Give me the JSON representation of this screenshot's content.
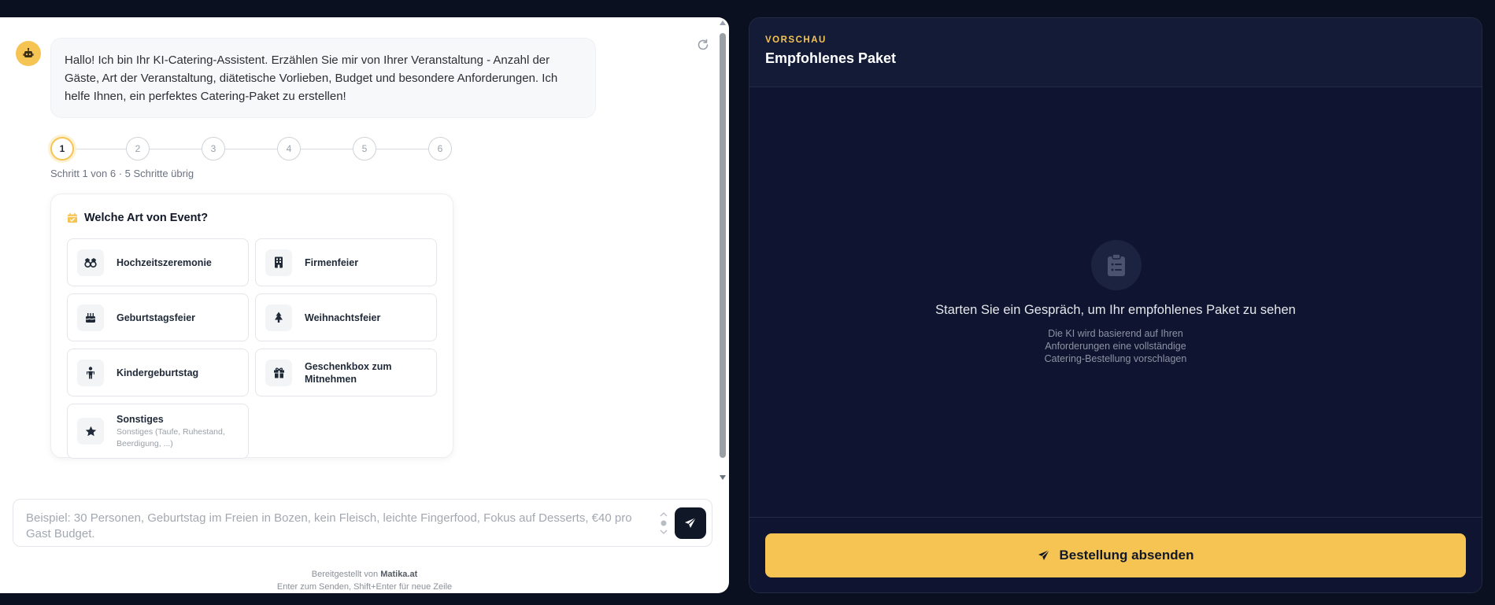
{
  "chat": {
    "bot_message": "Hallo! Ich bin Ihr KI-Catering-Assistent. Erzählen Sie mir von Ihrer Veranstaltung - Anzahl der Gäste, Art der Veranstaltung, diätetische Vorlieben, Budget und besondere Anforderungen. Ich helfe Ihnen, ein perfektes Catering-Paket zu erstellen!",
    "stepper": {
      "steps": [
        "1",
        "2",
        "3",
        "4",
        "5",
        "6"
      ],
      "current": 1,
      "status": "Schritt 1 von 6 · 5 Schritte übrig"
    },
    "question": {
      "title": "Welche Art von Event?",
      "options": [
        {
          "label": "Hochzeitszeremonie",
          "icon": "rings-icon"
        },
        {
          "label": "Firmenfeier",
          "icon": "building-icon"
        },
        {
          "label": "Geburtstagsfeier",
          "icon": "cake-icon"
        },
        {
          "label": "Weihnachtsfeier",
          "icon": "tree-icon"
        },
        {
          "label": "Kindergeburtstag",
          "icon": "child-icon"
        },
        {
          "label": "Geschenkbox zum Mitnehmen",
          "icon": "gift-icon"
        },
        {
          "label": "Sonstiges",
          "sub": "Sonstiges (Taufe, Ruhestand, Beerdigung, ...)",
          "icon": "star-icon"
        }
      ]
    },
    "input": {
      "placeholder": "Beispiel: 30 Personen, Geburtstag im Freien in Bozen, kein Fleisch, leichte Fingerfood, Fokus auf Desserts, €40 pro Gast Budget."
    },
    "footer": {
      "powered_prefix": "Bereitgestellt von",
      "powered_brand": "Matika.at",
      "hint": "Enter zum Senden, Shift+Enter für neue Zeile"
    }
  },
  "preview": {
    "kicker": "VORSCHAU",
    "title": "Empfohlenes Paket",
    "empty_title": "Starten Sie ein Gespräch, um Ihr empfohlenes Paket zu sehen",
    "empty_desc": [
      "Die KI wird basierend auf Ihren",
      "Anforderungen eine vollständige",
      "Catering-Bestellung vorschlagen"
    ],
    "submit_label": "Bestellung absenden"
  },
  "colors": {
    "accent": "#f6c453",
    "dark": "#101828",
    "page_bg": "#0b1020",
    "panel_bg": "#0f1530"
  }
}
